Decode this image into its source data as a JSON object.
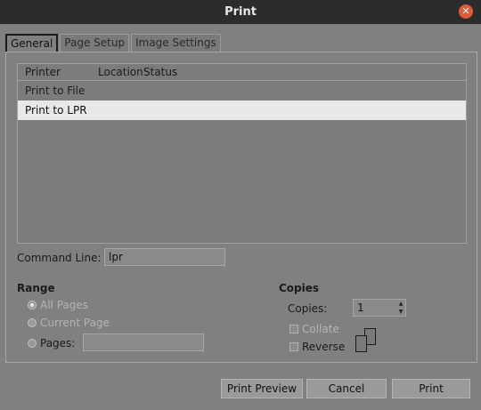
{
  "window": {
    "title": "Print",
    "close_icon": "close-icon"
  },
  "tabs": [
    {
      "label": "General",
      "active": true
    },
    {
      "label": "Page Setup",
      "active": false
    },
    {
      "label": "Image Settings",
      "active": false
    }
  ],
  "printer_list": {
    "columns": [
      "Printer",
      "Location",
      "Status"
    ],
    "rows": [
      {
        "name": "Print to File",
        "selected": false
      },
      {
        "name": "Print to LPR",
        "selected": true
      }
    ]
  },
  "command_line": {
    "label": "Command Line:",
    "value": "lpr"
  },
  "range": {
    "title": "Range",
    "all_pages": "All Pages",
    "current_page": "Current Page",
    "pages": "Pages:"
  },
  "copies": {
    "title": "Copies",
    "copies_label": "Copies:",
    "copies_value": "1",
    "collate": "Collate",
    "reverse": "Reverse"
  },
  "buttons": {
    "print_preview": "Print Preview",
    "cancel": "Cancel",
    "print": "Print"
  },
  "colors": {
    "close_button": "#e05a3a",
    "titlebar": "#2c2c2c",
    "selected_row": "#e8e8e8"
  }
}
